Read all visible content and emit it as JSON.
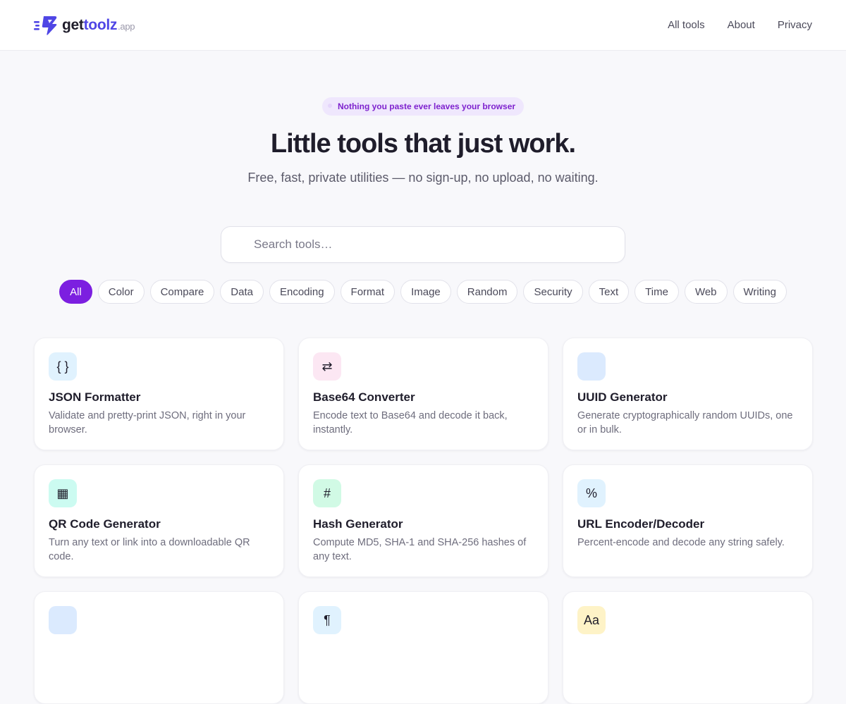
{
  "header": {
    "brand": {
      "get": "get",
      "toolz": "toolz",
      "tld": ".app"
    },
    "nav": [
      "All tools",
      "About",
      "Privacy"
    ]
  },
  "hero": {
    "note": "Nothing you paste ever leaves your browser",
    "title": "Little tools that just work.",
    "subtitle": "Free, fast, private utilities — no sign-up, no upload, no waiting."
  },
  "search": {
    "placeholder": "Search tools…",
    "value": ""
  },
  "filters": {
    "selected": "All",
    "items": [
      "All",
      "Color",
      "Compare",
      "Data",
      "Encoding",
      "Format",
      "Image",
      "Random",
      "Security",
      "Text",
      "Time",
      "Web",
      "Writing"
    ]
  },
  "tools": [
    {
      "title": "JSON Formatter",
      "desc": "Validate and pretty-print JSON, right in your browser.",
      "icon": "braces-icon",
      "glyph": "{ }",
      "icon_bg": "#e0f2fe"
    },
    {
      "title": "Base64 Converter",
      "desc": "Encode text to Base64 and decode it back, instantly.",
      "icon": "swap-arrows-icon",
      "glyph": "⇄",
      "icon_bg": "#fce7f3"
    },
    {
      "title": "UUID Generator",
      "desc": "Generate cryptographically random UUIDs, one or in bulk.",
      "icon": "uuid-icon",
      "glyph": "",
      "icon_bg": "#dbeafe"
    },
    {
      "title": "QR Code Generator",
      "desc": "Turn any text or link into a downloadable QR code.",
      "icon": "qr-grid-icon",
      "glyph": "▦",
      "icon_bg": "#ccfbf1"
    },
    {
      "title": "Hash Generator",
      "desc": "Compute MD5, SHA-1 and SHA-256 hashes of any text.",
      "icon": "hash-icon",
      "glyph": "#",
      "icon_bg": "#d1fae5"
    },
    {
      "title": "URL Encoder/Decoder",
      "desc": "Percent-encode and decode any string safely.",
      "icon": "percent-icon",
      "glyph": "%",
      "icon_bg": "#e0f2fe"
    },
    {
      "title": "",
      "desc": "",
      "icon": "tool-icon",
      "glyph": "",
      "icon_bg": "#dbeafe"
    },
    {
      "title": "",
      "desc": "",
      "icon": "pilcrow-icon",
      "glyph": "¶",
      "icon_bg": "#e0f2fe"
    },
    {
      "title": "",
      "desc": "",
      "icon": "text-case-icon",
      "glyph": "Aa",
      "icon_bg": "#fef3c7"
    }
  ],
  "colors": {
    "accent": "#7c1fe0",
    "brand": "#4f46e5"
  }
}
